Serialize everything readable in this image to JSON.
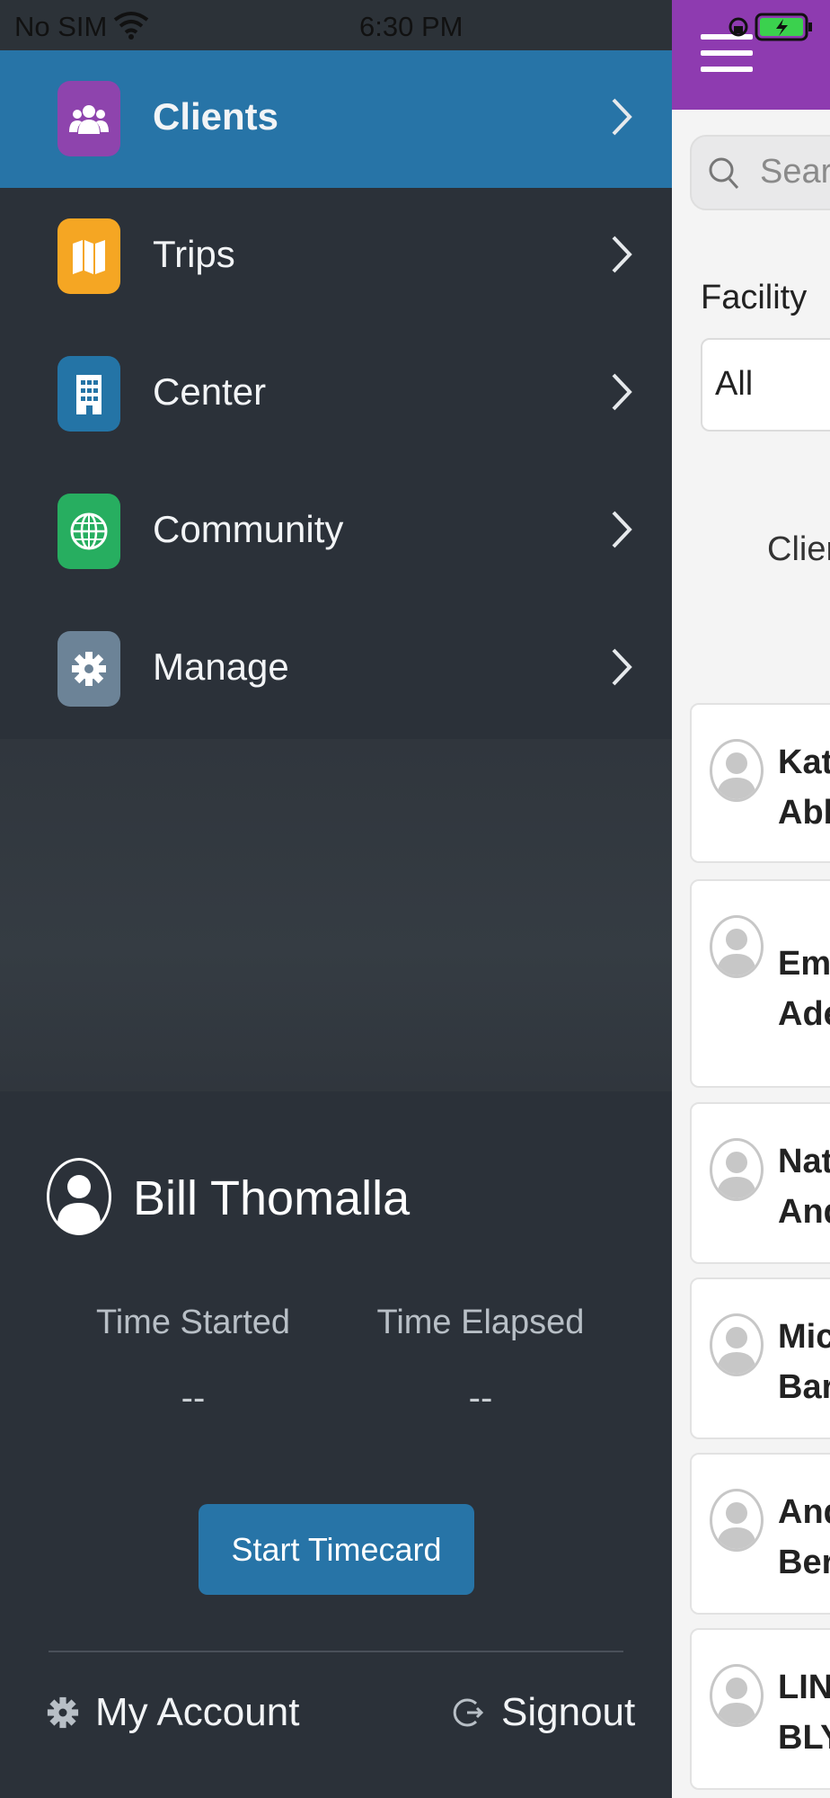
{
  "status_bar": {
    "carrier": "No SIM",
    "time": "6:30 PM"
  },
  "menu": [
    {
      "label": "Clients",
      "icon": "clients-icon",
      "color": "#8e44ad",
      "active": true
    },
    {
      "label": "Trips",
      "icon": "map-icon",
      "color": "#f5a623",
      "active": false
    },
    {
      "label": "Center",
      "icon": "building-icon",
      "color": "#2474a6",
      "active": false
    },
    {
      "label": "Community",
      "icon": "globe-icon",
      "color": "#27ae60",
      "active": false
    },
    {
      "label": "Manage",
      "icon": "gear-icon",
      "color": "#6c8397",
      "active": false
    }
  ],
  "user": {
    "name": "Bill Thomalla"
  },
  "timecard": {
    "started_label": "Time Started",
    "started_value": "--",
    "elapsed_label": "Time Elapsed",
    "elapsed_value": "--",
    "button_label": "Start Timecard"
  },
  "footer": {
    "account_label": "My Account",
    "signout_label": "Signout"
  },
  "background_app": {
    "search_placeholder": "Search",
    "facility_label": "Facility",
    "facility_value": "All",
    "clients_header": "Clients",
    "clients": [
      {
        "first": "Kat",
        "last": "Abb"
      },
      {
        "first": "Emr",
        "last": "Ade"
      },
      {
        "first": "Nat",
        "last": "And"
      },
      {
        "first": "Mic",
        "last": "Bar"
      },
      {
        "first": "And",
        "last": "Ber"
      },
      {
        "first": "LIN",
        "last": "BLY"
      }
    ]
  },
  "colors": {
    "accent": "#2774a7",
    "header": "#8e3bb0",
    "drawer": "#2b3139"
  }
}
